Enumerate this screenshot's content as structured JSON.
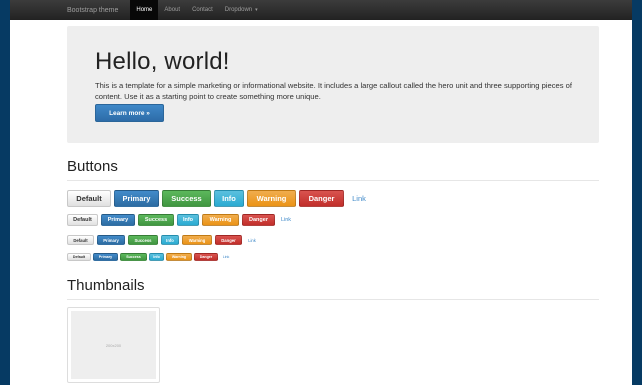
{
  "navbar": {
    "brand": "Bootstrap theme",
    "items": [
      {
        "label": "Home",
        "active": true
      },
      {
        "label": "About",
        "active": false
      },
      {
        "label": "Contact",
        "active": false
      },
      {
        "label": "Dropdown",
        "active": false,
        "caret": "▾"
      }
    ]
  },
  "jumbotron": {
    "heading": "Hello, world!",
    "text": "This is a template for a simple marketing or informational website. It includes a large callout called the hero unit and three supporting pieces of content. Use it as a starting point to create something more unique.",
    "button": "Learn more »"
  },
  "buttons_section": {
    "title": "Buttons",
    "labels": {
      "default": "Default",
      "primary": "Primary",
      "success": "Success",
      "info": "Info",
      "warning": "Warning",
      "danger": "Danger",
      "link": "Link"
    }
  },
  "thumbnails_section": {
    "title": "Thumbnails",
    "placeholder": "200x200"
  },
  "colors": {
    "primary": "#428bca",
    "success": "#5cb85c",
    "info": "#5bc0de",
    "warning": "#f0ad4e",
    "danger": "#d9534f",
    "navbar": "#222222",
    "jumbotron": "#eeeeee"
  }
}
